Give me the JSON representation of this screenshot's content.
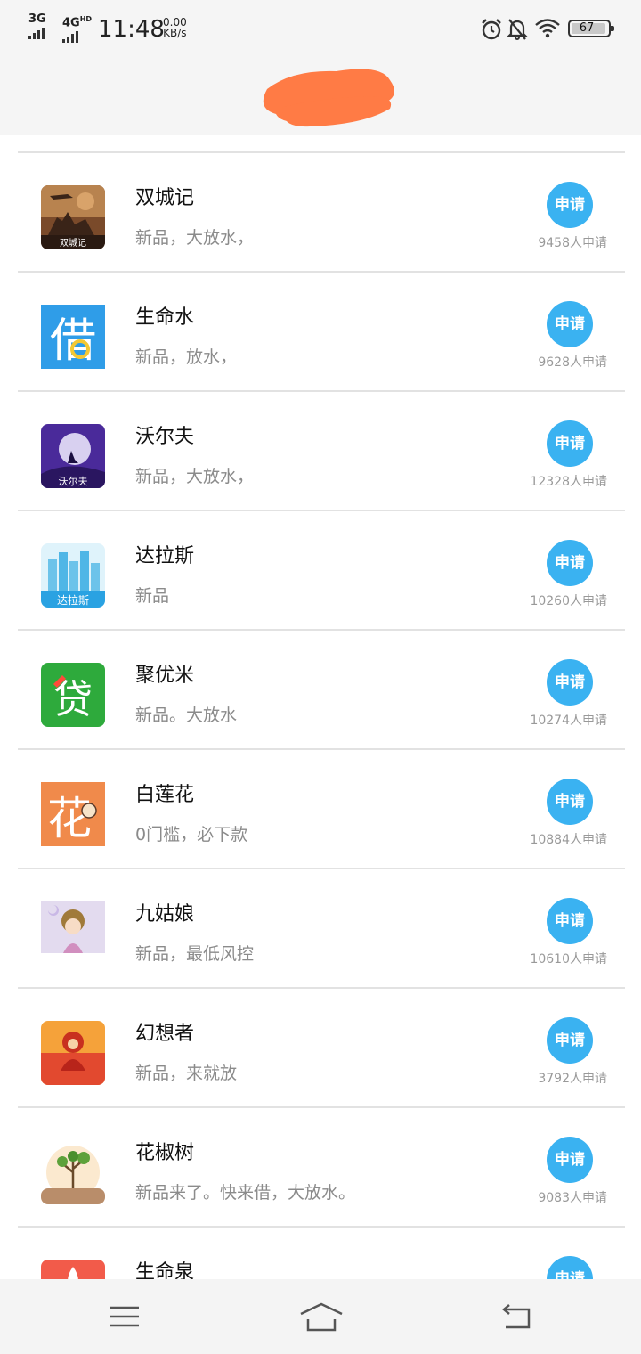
{
  "status_bar": {
    "net1": "3G",
    "net2": "4G",
    "net2_sup": "HD",
    "time": "11:48",
    "speed_value": "0.00",
    "speed_unit": "KB/s",
    "battery": "67",
    "icons": [
      "alarm-icon",
      "bell-off-icon",
      "wifi-icon",
      "battery-icon"
    ]
  },
  "accent_color": "#3ab2f1",
  "redaction_color": "#ff7b45",
  "items": [
    {
      "name": "双城记",
      "desc": "新品，大放水，",
      "button": "申请",
      "count": "9458人申请",
      "logo": "shuangchengji-logo"
    },
    {
      "name": "生命水",
      "desc": "新品，放水，",
      "button": "申请",
      "count": "9628人申请",
      "logo": "jie-logo"
    },
    {
      "name": "沃尔夫",
      "desc": "新品，大放水，",
      "button": "申请",
      "count": "12328人申请",
      "logo": "woerfu-logo",
      "logo_text": "沃尔夫"
    },
    {
      "name": "达拉斯",
      "desc": "新品",
      "button": "申请",
      "count": "10260人申请",
      "logo": "dalasi-logo",
      "logo_text": "达拉斯"
    },
    {
      "name": "聚优米",
      "desc": "新品。大放水",
      "button": "申请",
      "count": "10274人申请",
      "logo": "dai-logo"
    },
    {
      "name": "白莲花",
      "desc": "0门槛，必下款",
      "button": "申请",
      "count": "10884人申请",
      "logo": "hua-logo"
    },
    {
      "name": "九姑娘",
      "desc": "新品，最低风控",
      "button": "申请",
      "count": "10610人申请",
      "logo": "jiuguniang-logo"
    },
    {
      "name": "幻想者",
      "desc": "新品，来就放",
      "button": "申请",
      "count": "3792人申请",
      "logo": "huanxiangzhe-logo"
    },
    {
      "name": "花椒树",
      "desc": "新品来了。快来借，大放水。",
      "button": "申请",
      "count": "9083人申请",
      "logo": "huajiaoshu-logo"
    },
    {
      "name": "生命泉",
      "desc": "",
      "button": "申请",
      "count": "",
      "logo": "shengmingquan-logo"
    }
  ],
  "nav_bar": [
    "menu-icon",
    "home-icon",
    "back-icon"
  ]
}
